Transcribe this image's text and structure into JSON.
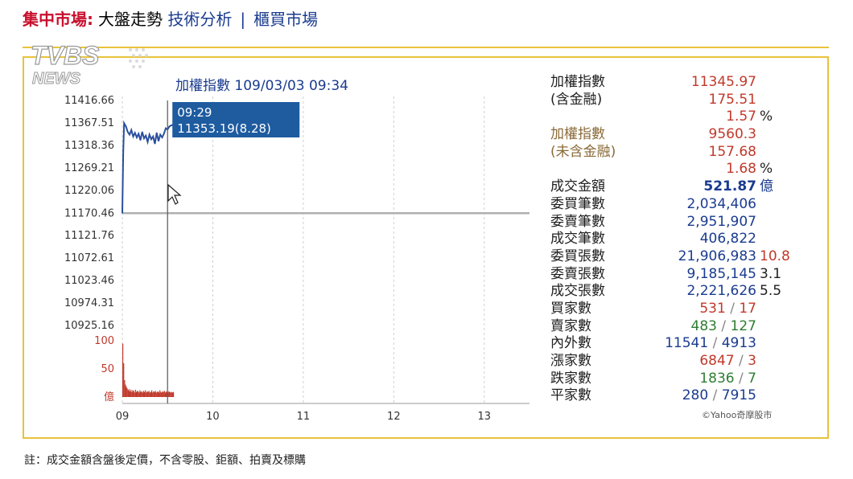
{
  "header": {
    "market": "集中市場:",
    "trend": "大盤走勢",
    "analysis_link": "技術分析",
    "separator": "|",
    "otc_link": "櫃買市場"
  },
  "logo": {
    "brand": "TVBS",
    "sub": "NEWS"
  },
  "chart_data": {
    "type": "line",
    "title": "加權指數 109/03/03 09:34",
    "x_ticks": [
      "09",
      "10",
      "11",
      "12",
      "13"
    ],
    "x_range": [
      9,
      13.5
    ],
    "y_ticks": [
      "11416.66",
      "11367.51",
      "11318.36",
      "11269.21",
      "11220.06",
      "11170.46",
      "11121.76",
      "11072.61",
      "11023.46",
      "10974.31",
      "10925.16"
    ],
    "ylim": [
      10925.16,
      11416.66
    ],
    "reference_value": 11170.46,
    "series": [
      {
        "x": [
          9.0,
          9.01,
          9.02,
          9.04,
          9.06,
          9.08,
          9.1,
          9.12,
          9.14,
          9.16,
          9.18,
          9.2,
          9.22,
          9.24,
          9.26,
          9.28,
          9.3,
          9.32,
          9.34,
          9.36,
          9.38,
          9.4,
          9.42,
          9.44,
          9.46,
          9.48,
          9.5,
          9.52,
          9.54,
          9.57
        ],
        "values": [
          11170.46,
          11300,
          11367,
          11360,
          11348,
          11342,
          11352,
          11338,
          11346,
          11336,
          11344,
          11330,
          11348,
          11334,
          11340,
          11326,
          11342,
          11332,
          11338,
          11322,
          11346,
          11328,
          11342,
          11336,
          11344,
          11356,
          11353.19,
          11360,
          11362,
          11364
        ]
      }
    ],
    "volume": {
      "labels": [
        "100",
        "50",
        "億"
      ],
      "ylim": [
        0,
        100
      ],
      "x": [
        9.0,
        9.01,
        9.02,
        9.03,
        9.04,
        9.05,
        9.06,
        9.07,
        9.08,
        9.09,
        9.1,
        9.11,
        9.12,
        9.13,
        9.14,
        9.15,
        9.16,
        9.17,
        9.18,
        9.19,
        9.2,
        9.21,
        9.22,
        9.23,
        9.24,
        9.25,
        9.26,
        9.27,
        9.28,
        9.29,
        9.3,
        9.31,
        9.32,
        9.33,
        9.34,
        9.35,
        9.36,
        9.37,
        9.38,
        9.39,
        9.4,
        9.41,
        9.42,
        9.43,
        9.44,
        9.45,
        9.46,
        9.47,
        9.48,
        9.49,
        9.5,
        9.51,
        9.52,
        9.53,
        9.54,
        9.55,
        9.56
      ],
      "values": [
        95,
        60,
        30,
        22,
        18,
        15,
        12,
        14,
        10,
        13,
        9,
        12,
        11,
        8,
        13,
        9,
        11,
        10,
        8,
        12,
        9,
        10,
        8,
        11,
        9,
        12,
        8,
        10,
        9,
        11,
        8,
        9,
        12,
        8,
        10,
        9,
        11,
        8,
        9,
        10,
        8,
        12,
        9,
        8,
        10,
        9,
        11,
        8,
        10,
        9,
        8,
        10,
        9,
        8,
        9,
        8,
        9
      ]
    },
    "tooltip": {
      "time": "09:29",
      "value": "11353.19(8.28)",
      "x": 9.5
    },
    "colors": {
      "line": "#2b4f9e",
      "volume": "#c0392b",
      "tooltip_bg": "#1e5b9f",
      "reference": "#b0b0b0"
    }
  },
  "stats": {
    "rows": [
      {
        "label": "加權指數",
        "value": "11345.97",
        "extra": "",
        "color": "red"
      },
      {
        "label": "(含金融)",
        "value": "175.51",
        "extra": "",
        "color": "red"
      },
      {
        "label": "",
        "value": "1.57",
        "extra": "%",
        "color": "red"
      },
      {
        "label": "加權指數",
        "value": "9560.3",
        "extra": "",
        "color": "red",
        "tan": true
      },
      {
        "label": "(未含金融)",
        "value": "157.68",
        "extra": "",
        "color": "red",
        "tan": true
      },
      {
        "label": "",
        "value": "1.68",
        "extra": "%",
        "color": "red"
      },
      {
        "label": "成交金額",
        "value": "521.87",
        "extra": "億",
        "color": "blue",
        "bold": true
      },
      {
        "label": "委買筆數",
        "value": "2,034,406",
        "extra": "",
        "color": "blue"
      },
      {
        "label": "委賣筆數",
        "value": "2,951,907",
        "extra": "",
        "color": "blue"
      },
      {
        "label": "成交筆數",
        "value": "406,822",
        "extra": "",
        "color": "blue"
      },
      {
        "label": "委買張數",
        "value": "21,906,983",
        "extra": "10.8",
        "color": "blue",
        "extra_color": "red"
      },
      {
        "label": "委賣張數",
        "value": "9,185,145",
        "extra": "3.1",
        "color": "blue"
      },
      {
        "label": "成交張數",
        "value": "2,221,626",
        "extra": "5.5",
        "color": "blue"
      },
      {
        "label": "買家數",
        "value_a": "531",
        "value_b": "17",
        "color": "red"
      },
      {
        "label": "賣家數",
        "value_a": "483",
        "value_b": "127",
        "color": "green"
      },
      {
        "label": "內外數",
        "value_a": "11541",
        "value_b": "4913",
        "color": "blue"
      },
      {
        "label": "漲家數",
        "value_a": "6847",
        "value_b": "3",
        "color": "red"
      },
      {
        "label": "跌家數",
        "value_a": "1836",
        "value_b": "7",
        "color": "green"
      },
      {
        "label": "平家數",
        "value_a": "280",
        "value_b": "7915",
        "color": "blue"
      }
    ],
    "slash": "/"
  },
  "credit": "©Yahoo奇摩股市",
  "footnote": "註：成交金額含盤後定價，不含零股、鉅額、拍賣及標購"
}
